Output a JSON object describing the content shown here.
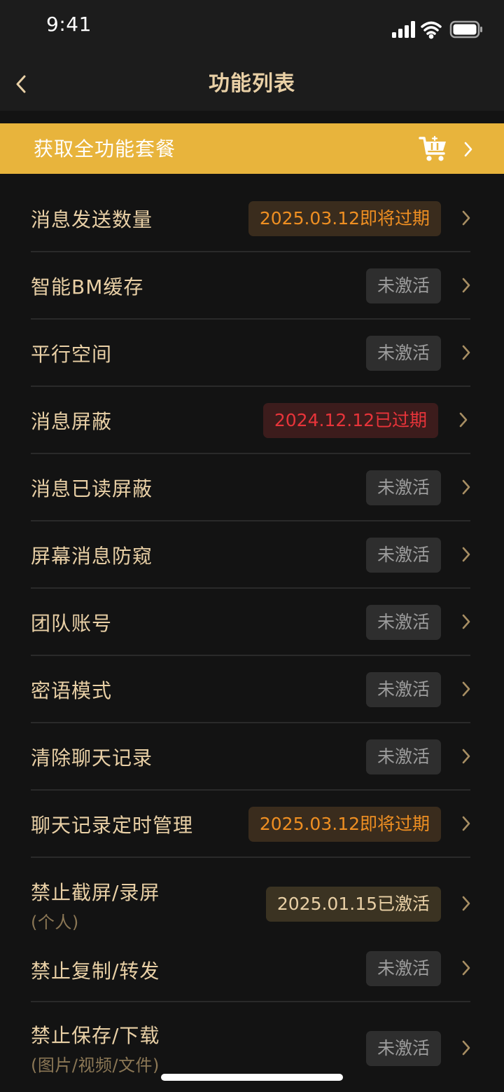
{
  "status_bar": {
    "time": "9:41"
  },
  "nav": {
    "title": "功能列表"
  },
  "promo": {
    "label": "获取全功能套餐",
    "icon": "cart-icon"
  },
  "colors": {
    "accent_gold": "#e8b43c",
    "text_gold": "#e9d0a6",
    "expiring": "#ef8f22",
    "expired": "#e8343a"
  },
  "features": [
    {
      "label": "消息发送数量",
      "status": "2025.03.12即将过期",
      "state": "expiring"
    },
    {
      "label": "智能BM缓存",
      "status": "未激活",
      "state": "inactive"
    },
    {
      "label": "平行空间",
      "status": "未激活",
      "state": "inactive"
    },
    {
      "label": "消息屏蔽",
      "status": "2024.12.12已过期",
      "state": "expired"
    },
    {
      "label": "消息已读屏蔽",
      "status": "未激活",
      "state": "inactive"
    },
    {
      "label": "屏幕消息防窥",
      "status": "未激活",
      "state": "inactive"
    },
    {
      "label": "团队账号",
      "status": "未激活",
      "state": "inactive"
    },
    {
      "label": "密语模式",
      "status": "未激活",
      "state": "inactive"
    },
    {
      "label": "清除聊天记录",
      "status": "未激活",
      "state": "inactive"
    },
    {
      "label": "聊天记录定时管理",
      "status": "2025.03.12即将过期",
      "state": "expiring"
    },
    {
      "label": "禁止截屏/录屏",
      "sub": "(个人)",
      "status": "2025.01.15已激活",
      "state": "active"
    },
    {
      "label": "禁止复制/转发",
      "status": "未激活",
      "state": "inactive"
    },
    {
      "label": "禁止保存/下载",
      "sub": "(图片/视频/文件)",
      "status": "未激活",
      "state": "inactive"
    }
  ]
}
